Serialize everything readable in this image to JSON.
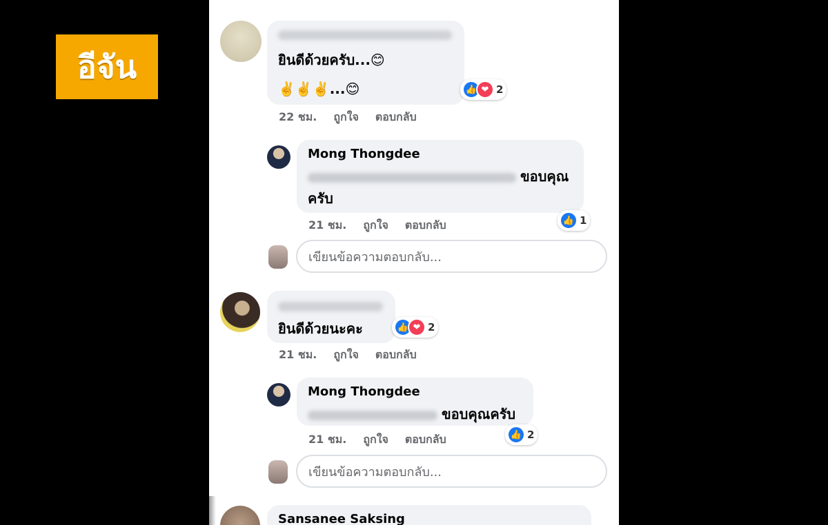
{
  "logo": {
    "text": "อีจัน",
    "color": "#f6a800"
  },
  "comments": [
    {
      "name_hidden": "blurred",
      "lines": [
        "ยินดีด้วยครับ...😊",
        "✌️✌️✌️...😊"
      ],
      "reactions": {
        "like": true,
        "love": true,
        "count": "2"
      },
      "meta": {
        "time": "22 ชม.",
        "like": "ถูกใจ",
        "reply": "ตอบกลับ"
      },
      "reply": {
        "author": "Mong Thongdee",
        "mention_hidden": "Somchai Likhitwadhanakij",
        "text_line1": "ขอบคุณ",
        "text_line2": "ครับ",
        "reactions": {
          "like": true,
          "count": "1"
        },
        "meta": {
          "time": "21 ชม.",
          "like": "ถูกใจ",
          "reply": "ตอบกลับ"
        }
      },
      "reply_placeholder": "เขียนข้อความตอบกลับ..."
    },
    {
      "name_hidden": "blurred",
      "text": "ยินดีด้วยนะคะ",
      "reactions": {
        "like": true,
        "love": true,
        "count": "2"
      },
      "meta": {
        "time": "21 ชม.",
        "like": "ถูกใจ",
        "reply": "ตอบกลับ"
      },
      "reply": {
        "author": "Mong Thongdee",
        "text": "ขอบคุณครับ",
        "reactions": {
          "like": true,
          "count": "2"
        },
        "meta": {
          "time": "21 ชม.",
          "like": "ถูกใจ",
          "reply": "ตอบกลับ"
        }
      },
      "reply_placeholder": "เขียนข้อความตอบกลับ..."
    },
    {
      "author": "Sansanee Saksing"
    }
  ],
  "icons": {
    "like": "thumbs-up-icon",
    "love": "heart-icon"
  }
}
